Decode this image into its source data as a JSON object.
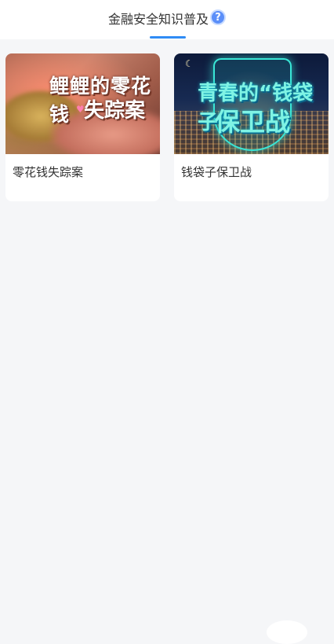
{
  "header": {
    "tab_label": "金融安全知识普及",
    "help_icon": "?"
  },
  "cards": [
    {
      "title": "零花钱失踪案",
      "image_line1": "鲤鲤的零花钱",
      "image_line2": "失踪案"
    },
    {
      "title": "钱袋子保卫战",
      "image_line1": "青春的“钱袋子”",
      "image_line2": "保卫战"
    }
  ]
}
